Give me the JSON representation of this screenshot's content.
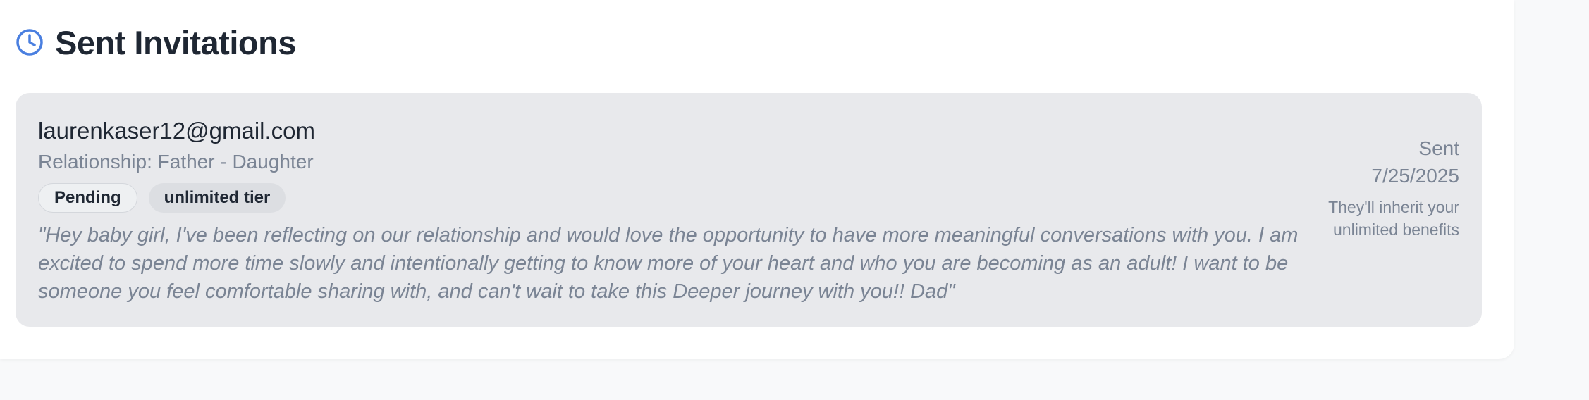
{
  "header": {
    "title": "Sent Invitations",
    "icon": "clock-icon",
    "icon_color": "#4a7fe0"
  },
  "invitations": [
    {
      "email": "laurenkaser12@gmail.com",
      "relationship": "Relationship: Father - Daughter",
      "status": "Pending",
      "tier": "unlimited tier",
      "message": "\"Hey baby girl, I've been reflecting on our relationship and would love the opportunity to have more meaningful conversations with you. I am excited to spend more time slowly and intentionally getting to know more of your heart and who you are becoming as an adult! I want to be someone you feel comfortable sharing with, and can't wait to take this Deeper journey with you!! Dad\"",
      "sent_label": "Sent",
      "sent_date": "7/25/2025",
      "inherit_note": "They'll inherit your unlimited benefits"
    }
  ],
  "colors": {
    "card_bg": "#e8e9ec",
    "text_dark": "#1f2733",
    "text_muted": "#7a8494"
  }
}
